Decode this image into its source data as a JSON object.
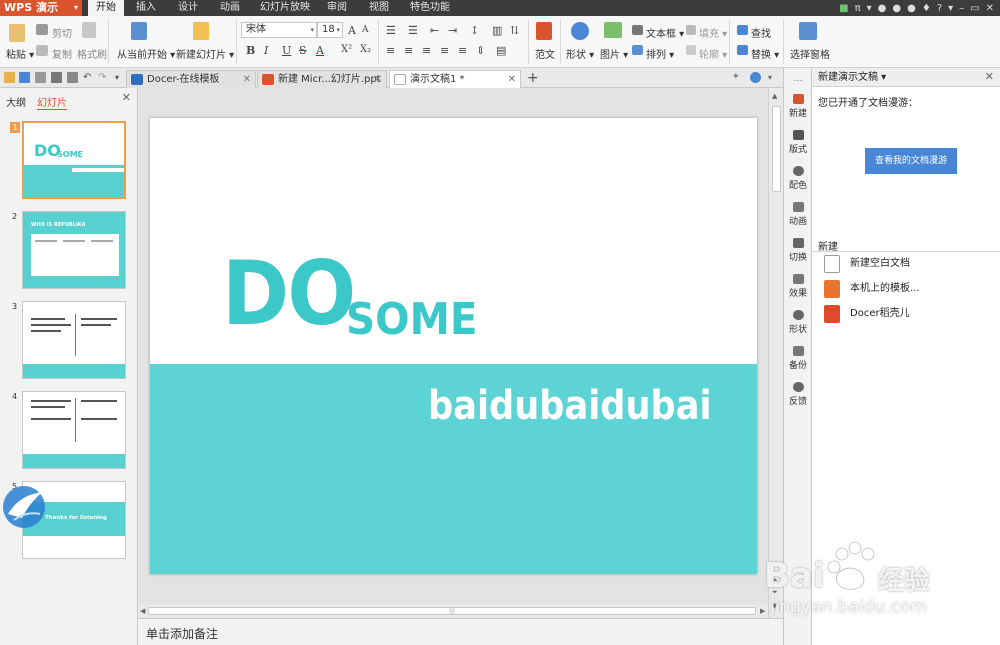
{
  "app": {
    "name": "WPS 演示",
    "accent": "#d9532c"
  },
  "menu": {
    "tabs": [
      {
        "label": "开始",
        "active": true
      },
      {
        "label": "插入"
      },
      {
        "label": "设计"
      },
      {
        "label": "动画"
      },
      {
        "label": "幻灯片放映"
      },
      {
        "label": "审阅"
      },
      {
        "label": "视图"
      },
      {
        "label": "特色功能"
      }
    ],
    "right_glyph": "π"
  },
  "ribbon": {
    "paste": "粘贴",
    "cut": "剪切",
    "copy": "复制",
    "format_painter": "格式刷",
    "from_current": "从当前开始",
    "new_slide": "新建幻灯片",
    "font_name": "宋体",
    "font_size": "18",
    "bold": "B",
    "italic": "I",
    "underline": "U",
    "strike": "S",
    "superscript": "X²",
    "subscript": "X₂",
    "grow_font": "A",
    "shrink_font": "A",
    "font_color": "A",
    "template": "范文",
    "shape": "形状",
    "picture": "图片",
    "textbox": "文本框",
    "fill": "填充",
    "arrange": "排列",
    "outline": "轮廓",
    "find": "查找",
    "replace": "替换",
    "select_pane": "选择窗格"
  },
  "tabs": [
    {
      "label": "Docer-在线模板",
      "icon_color": "#2f6fc0",
      "active": false
    },
    {
      "label": "新建 Micr...幻灯片.ppt",
      "icon_color": "#d9532c",
      "active": false
    },
    {
      "label": "演示文稿1 *",
      "icon_color": "#ffffff",
      "active": true
    }
  ],
  "leftpane": {
    "tab_outline": "大纲",
    "tab_slides": "幻灯片",
    "slides": [
      {
        "num": "1",
        "selected": true,
        "do_text": "DO",
        "some_text": "SOME"
      },
      {
        "num": "2",
        "selected": false,
        "heading": "WHO IS REPUBLIKA"
      },
      {
        "num": "3",
        "selected": false
      },
      {
        "num": "4",
        "selected": false
      },
      {
        "num": "5",
        "selected": false,
        "caption": "Thanks for listening"
      }
    ]
  },
  "slide": {
    "title_big": "DO",
    "title_small": "SOME",
    "subtitle": "baidubaidubai",
    "teal": "#5dd3d5",
    "text_teal": "#3cc8c8"
  },
  "notes": {
    "placeholder": "单击添加备注"
  },
  "rightstrip": {
    "items": [
      {
        "label": "新建",
        "color": "#d9532c"
      },
      {
        "label": "版式",
        "color": "#555555"
      },
      {
        "label": "配色",
        "color": "#666666"
      },
      {
        "label": "动画",
        "color": "#666666"
      },
      {
        "label": "切换",
        "color": "#666666"
      },
      {
        "label": "效果",
        "color": "#666666"
      },
      {
        "label": "形状",
        "color": "#666666"
      },
      {
        "label": "备份",
        "color": "#666666"
      },
      {
        "label": "反馈",
        "color": "#666666"
      }
    ]
  },
  "taskpane": {
    "header": "新建演示文稿",
    "sync_text": "您已开通了文档漫游：",
    "sync_button": "查看我的文档漫游",
    "new_title": "新建",
    "items": [
      {
        "label": "新建空白文档",
        "icon_color": "#ffffff"
      },
      {
        "label": "本机上的模板...",
        "icon_color": "#e9742d"
      },
      {
        "label": "Docer稻壳儿",
        "icon_color": "#e04a2a"
      }
    ]
  },
  "watermark": {
    "brand": "Bai",
    "brand_cn": "经验",
    "url": "jingyan.baidu.com"
  }
}
